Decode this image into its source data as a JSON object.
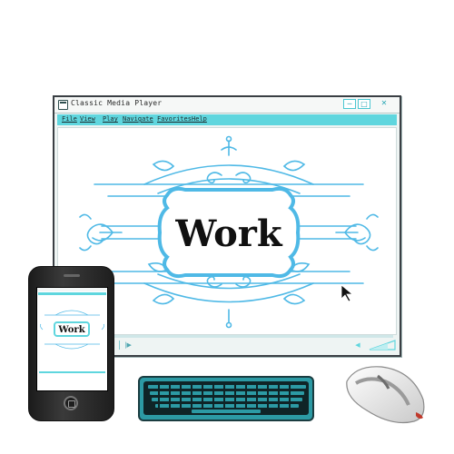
{
  "window": {
    "title": "Classic Media Player",
    "buttons": {
      "minimize": "─",
      "maximize": "□",
      "close": "✕"
    }
  },
  "menu": {
    "items": [
      "File",
      "View",
      "Play",
      "Navigate",
      "Favorites",
      "Help"
    ]
  },
  "content": {
    "word": "Work"
  },
  "controls": {
    "progress": 0.0
  },
  "phone": {
    "screen_word": "Work"
  },
  "colors": {
    "accent": "#5fd6de",
    "ornament": "#4fb9e6",
    "frame": "#3a3f44"
  }
}
